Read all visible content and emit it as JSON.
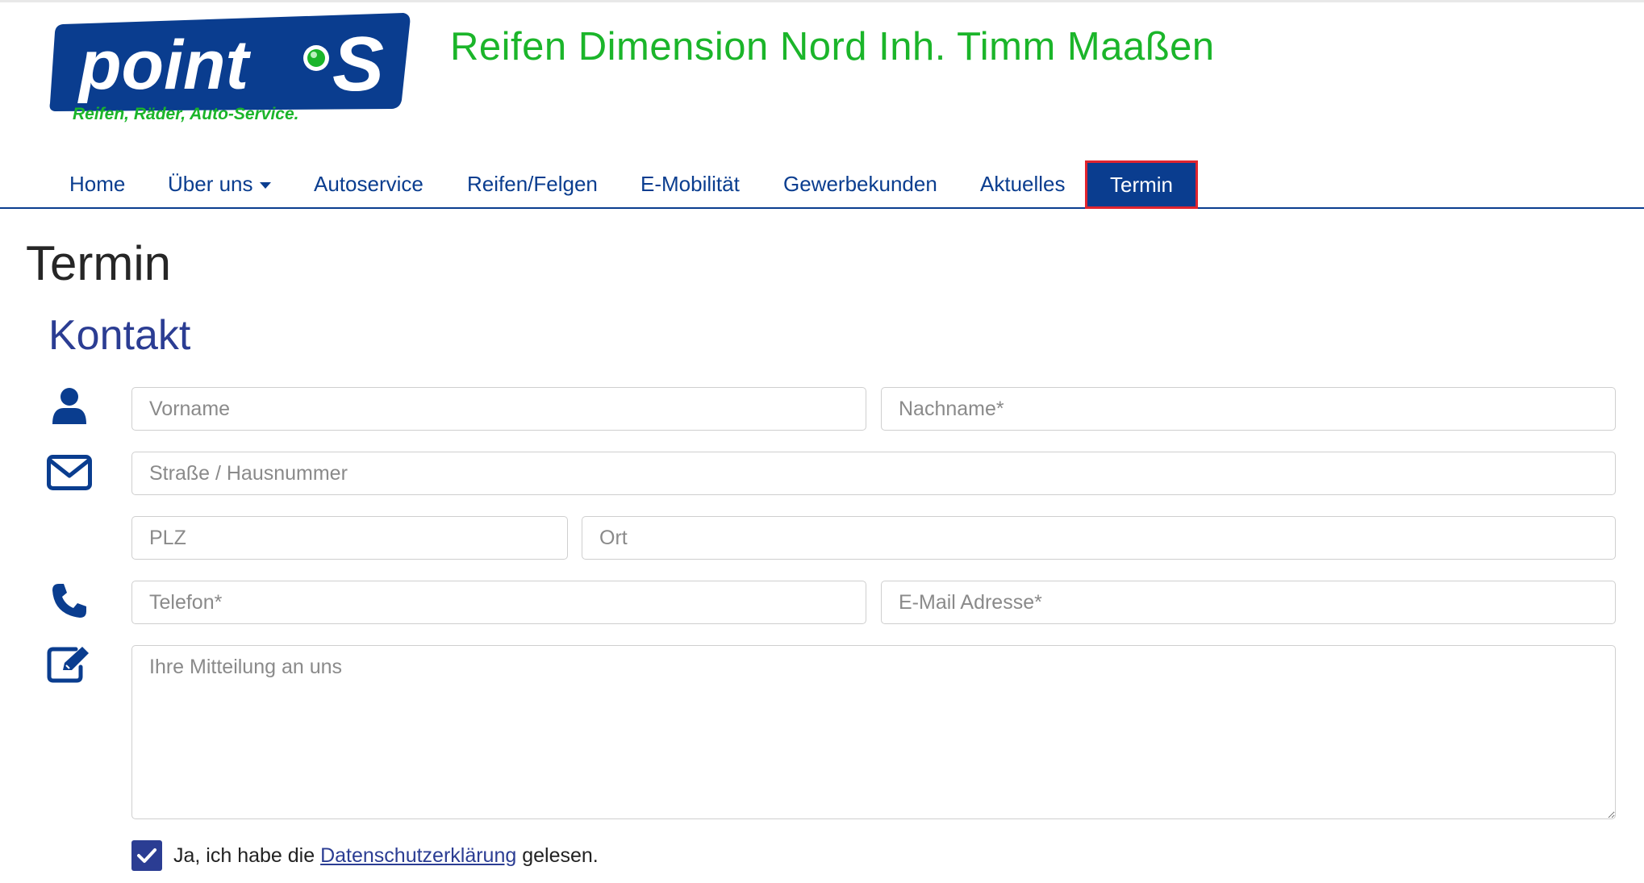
{
  "header": {
    "logo_word": "point",
    "logo_letter": "S",
    "logo_tagline": "Reifen, Räder, Auto-Service.",
    "site_title": "Reifen Dimension Nord Inh. Timm Maaßen"
  },
  "nav": {
    "items": [
      {
        "label": "Home"
      },
      {
        "label": "Über uns",
        "has_dropdown": true
      },
      {
        "label": "Autoservice"
      },
      {
        "label": "Reifen/Felgen"
      },
      {
        "label": "E-Mobilität"
      },
      {
        "label": "Gewerbekunden"
      },
      {
        "label": "Aktuelles"
      },
      {
        "label": "Termin",
        "active": true
      }
    ]
  },
  "page": {
    "title": "Termin",
    "section_title": "Kontakt"
  },
  "form": {
    "vorname": {
      "placeholder": "Vorname",
      "value": ""
    },
    "nachname": {
      "placeholder": "Nachname*",
      "value": ""
    },
    "strasse": {
      "placeholder": "Straße / Hausnummer",
      "value": ""
    },
    "plz": {
      "placeholder": "PLZ",
      "value": ""
    },
    "ort": {
      "placeholder": "Ort",
      "value": ""
    },
    "telefon": {
      "placeholder": "Telefon*",
      "value": ""
    },
    "email": {
      "placeholder": "E-Mail Adresse*",
      "value": ""
    },
    "mitteilung": {
      "placeholder": "Ihre Mitteilung an uns",
      "value": ""
    },
    "icons": [
      "person-icon",
      "envelope-icon",
      "phone-icon",
      "edit-icon"
    ]
  },
  "consent": {
    "checked": true,
    "text_before": "Ja, ich habe die ",
    "link_text": "Datenschutzerklärung",
    "text_after": " gelesen."
  },
  "colors": {
    "brand_blue": "#0a3d8f",
    "title_green": "#1bb52a",
    "heading_blue": "#2b3d93",
    "active_outline": "#e0242e"
  }
}
